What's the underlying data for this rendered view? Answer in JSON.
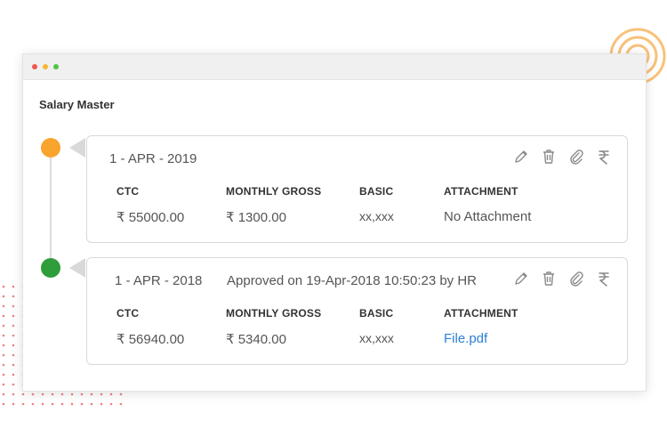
{
  "page": {
    "title": "Salary Master"
  },
  "colors": {
    "accent_orange": "#f9a42c",
    "accent_green": "#2e9d3a",
    "link": "#2a7fd4"
  },
  "columns": {
    "ctc": "CTC",
    "monthly_gross": "MONTHLY GROSS",
    "basic": "BASIC",
    "attachment": "ATTACHMENT"
  },
  "actions": [
    "pencil-icon",
    "trash-icon",
    "paperclip-icon",
    "rupee-icon"
  ],
  "records": [
    {
      "date": "1 - APR - 2019",
      "status": "",
      "ctc": "₹ 55000.00",
      "monthly_gross": "₹ 1300.00",
      "basic": "xx,xxx",
      "attachment": "No Attachment"
    },
    {
      "date": "1 - APR - 2018",
      "status": "Approved on 19-Apr-2018 10:50:23 by HR",
      "ctc": "₹ 56940.00",
      "monthly_gross": "₹ 5340.00",
      "basic": "xx,xxx",
      "attachment": "File.pdf"
    }
  ]
}
